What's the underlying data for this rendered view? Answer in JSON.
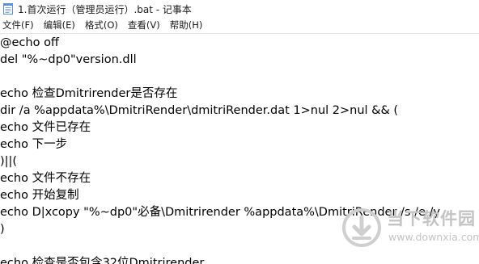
{
  "window": {
    "title": "1.首次运行（管理员运行）.bat - 记事本",
    "icon": "notepad-icon"
  },
  "menubar": {
    "items": [
      "文件(F)",
      "编辑(E)",
      "格式(O)",
      "查看(V)",
      "帮助(H)"
    ]
  },
  "editor": {
    "lines": [
      "@echo off",
      "del \"%~dp0\"version.dll",
      "",
      "echo 检查Dmitrirender是否存在",
      "dir /a %appdata%\\DmitriRender\\dmitriRender.dat 1>nul 2>nul && (",
      "echo 文件已存在",
      "echo 下一步",
      ")||(",
      "echo 文件不存在",
      "echo 开始复制",
      "echo D|xcopy \"%~dp0\"必备\\Dmitrirender %appdata%\\DmitriRender /s /e /y",
      ")",
      "",
      "echo 检查是否包含32位Dmitrirender"
    ]
  },
  "watermark": {
    "title": "当下软件园",
    "url": "www.downxia.com",
    "logo": "downxia-logo-icon"
  }
}
